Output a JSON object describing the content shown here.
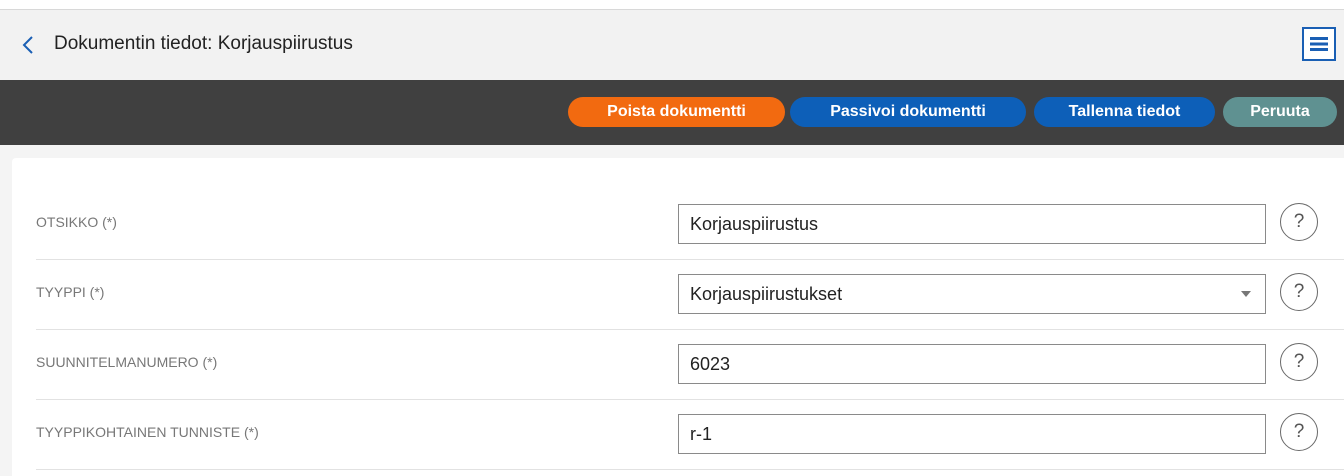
{
  "header": {
    "title": "Dokumentin tiedot: Korjauspiirustus",
    "back_icon": "chevron-left-icon",
    "menu_icon": "hamburger-menu-icon"
  },
  "toolbar": {
    "delete_label": "Poista dokumentti",
    "deactivate_label": "Passivoi dokumentti",
    "save_label": "Tallenna tiedot",
    "cancel_label": "Peruuta"
  },
  "form": {
    "rows": [
      {
        "label": "OTSIKKO (*)",
        "value": "Korjauspiirustus",
        "type": "text"
      },
      {
        "label": "TYYPPI (*)",
        "value": "Korjauspiirustukset",
        "type": "select"
      },
      {
        "label": "SUUNNITELMANUMERO (*)",
        "value": "6023",
        "type": "text"
      },
      {
        "label": "TYYPPIKOHTAINEN TUNNISTE (*)",
        "value": "r-1",
        "type": "text"
      }
    ],
    "help_symbol": "?"
  },
  "colors": {
    "accent_blue": "#0d5fb8",
    "delete_orange": "#f26a10",
    "cancel_teal": "#5f9191",
    "toolbar_bg": "#404040"
  }
}
